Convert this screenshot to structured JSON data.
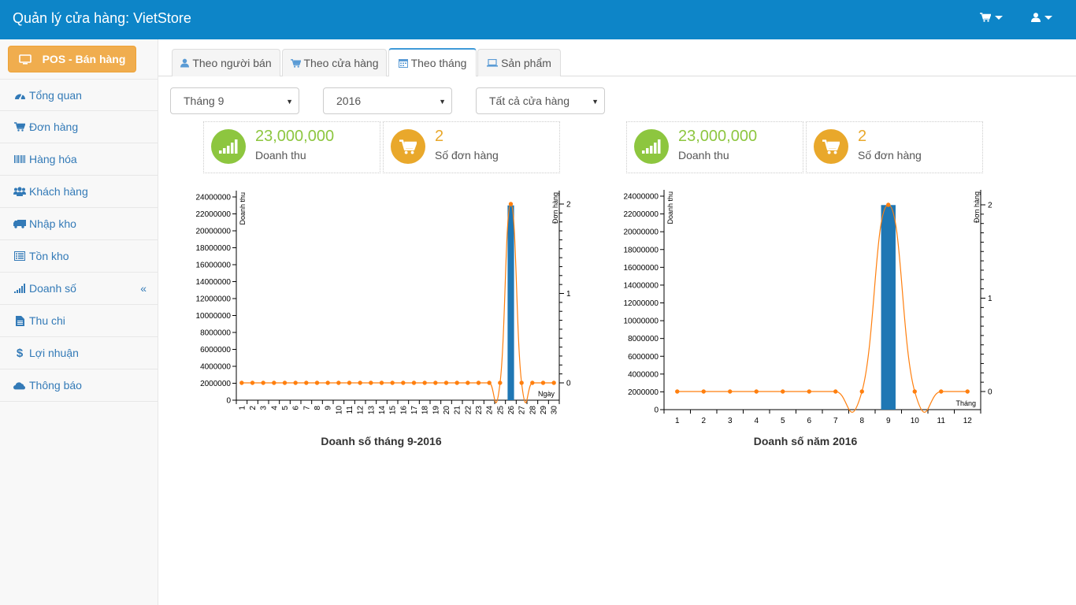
{
  "header": {
    "title": "Quản lý cửa hàng: VietStore",
    "cart_icon": "cart-icon",
    "user_icon": "user-icon"
  },
  "sidebar": {
    "pos_button": "POS - Bán hàng",
    "items": [
      {
        "label": "Tổng quan",
        "icon": "dashboard-icon"
      },
      {
        "label": "Đơn hàng",
        "icon": "cart-icon"
      },
      {
        "label": "Hàng hóa",
        "icon": "barcode-icon"
      },
      {
        "label": "Khách hàng",
        "icon": "users-icon"
      },
      {
        "label": "Nhập kho",
        "icon": "truck-icon"
      },
      {
        "label": "Tồn kho",
        "icon": "list-icon"
      },
      {
        "label": "Doanh số",
        "icon": "signal-icon",
        "arrow": "«"
      },
      {
        "label": "Thu chi",
        "icon": "file-icon"
      },
      {
        "label": "Lợi nhuận",
        "icon": "dollar-icon"
      },
      {
        "label": "Thông báo",
        "icon": "cloud-icon"
      }
    ]
  },
  "tabs": [
    {
      "label": "Theo người bán",
      "icon": "user-icon"
    },
    {
      "label": "Theo cửa hàng",
      "icon": "cart-icon"
    },
    {
      "label": "Theo tháng",
      "icon": "calendar-icon",
      "active": true
    },
    {
      "label": "Sản phẩm",
      "icon": "laptop-icon"
    }
  ],
  "filters": {
    "month": "Tháng 9",
    "year": "2016",
    "store": "Tất cả cửa hàng"
  },
  "stats": [
    {
      "value": "23,000,000",
      "label": "Doanh thu",
      "color": "#8dc63f"
    },
    {
      "value": "2",
      "label": "Số đơn hàng",
      "color": "#e9a82b"
    },
    {
      "value": "23,000,000",
      "label": "Doanh thu",
      "color": "#8dc63f"
    },
    {
      "value": "2",
      "label": "Số đơn hàng",
      "color": "#e9a82b"
    }
  ],
  "colors": {
    "bar": "#1f77b4",
    "line": "#ff7f0e",
    "header": "#0d85c8",
    "link": "#337ab7"
  },
  "chart_data": [
    {
      "type": "bar",
      "title": "Doanh số tháng 9-2016",
      "xlabel": "Ngày",
      "ylabel": "Doanh thu",
      "y2label": "Đơn hàng",
      "categories": [
        "1",
        "2",
        "3",
        "4",
        "5",
        "6",
        "7",
        "8",
        "9",
        "10",
        "11",
        "12",
        "13",
        "14",
        "15",
        "16",
        "17",
        "18",
        "19",
        "20",
        "21",
        "22",
        "23",
        "24",
        "25",
        "26",
        "27",
        "28",
        "29",
        "30"
      ],
      "ylim": [
        0,
        24000000
      ],
      "y_ticks": [
        "0",
        "2000000",
        "4000000",
        "6000000",
        "8000000",
        "10000000",
        "12000000",
        "14000000",
        "16000000",
        "18000000",
        "20000000",
        "22000000",
        "24000000"
      ],
      "y2lim": [
        0,
        2
      ],
      "y2_ticks": [
        "0",
        "1",
        "2"
      ],
      "series": [
        {
          "name": "Doanh thu",
          "type": "bar",
          "values": [
            0,
            0,
            0,
            0,
            0,
            0,
            0,
            0,
            0,
            0,
            0,
            0,
            0,
            0,
            0,
            0,
            0,
            0,
            0,
            0,
            0,
            0,
            0,
            0,
            0,
            23000000,
            0,
            0,
            0,
            0
          ]
        },
        {
          "name": "Đơn hàng",
          "type": "line",
          "axis": "right",
          "values": [
            0,
            0,
            0,
            0,
            0,
            0,
            0,
            0,
            0,
            0,
            0,
            0,
            0,
            0,
            0,
            0,
            0,
            0,
            0,
            0,
            0,
            0,
            0,
            0,
            0,
            2,
            0,
            0,
            0,
            0
          ]
        }
      ]
    },
    {
      "type": "bar",
      "title": "Doanh số năm 2016",
      "xlabel": "Tháng",
      "ylabel": "Doanh thu",
      "y2label": "Đơn hàng",
      "categories": [
        "1",
        "2",
        "3",
        "4",
        "5",
        "6",
        "7",
        "8",
        "9",
        "10",
        "11",
        "12"
      ],
      "ylim": [
        0,
        24000000
      ],
      "y_ticks": [
        "0",
        "2000000",
        "4000000",
        "6000000",
        "8000000",
        "10000000",
        "12000000",
        "14000000",
        "16000000",
        "18000000",
        "20000000",
        "22000000",
        "24000000"
      ],
      "y2lim": [
        0,
        2
      ],
      "y2_ticks": [
        "0",
        "1",
        "2"
      ],
      "series": [
        {
          "name": "Doanh thu",
          "type": "bar",
          "values": [
            0,
            0,
            0,
            0,
            0,
            0,
            0,
            0,
            23000000,
            0,
            0,
            0
          ]
        },
        {
          "name": "Đơn hàng",
          "type": "line",
          "axis": "right",
          "values": [
            0,
            0,
            0,
            0,
            0,
            0,
            0,
            0,
            2,
            0,
            0,
            0
          ]
        }
      ]
    }
  ]
}
